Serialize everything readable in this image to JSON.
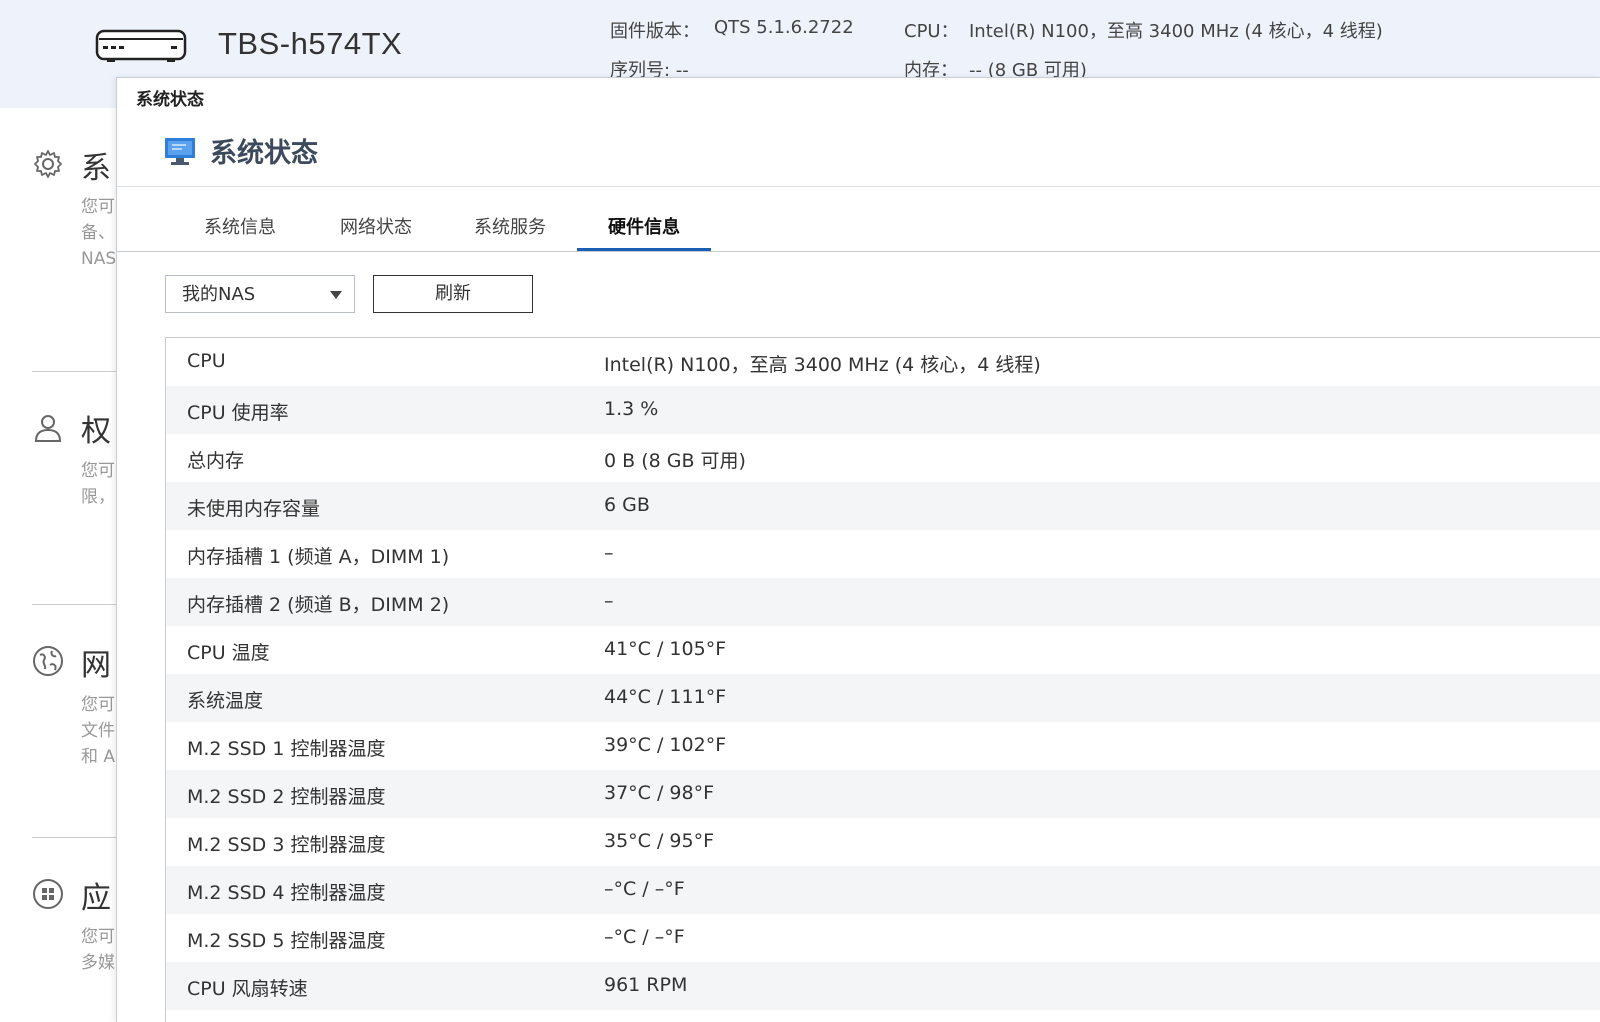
{
  "header": {
    "device_name": "TBS-h574TX",
    "firmware_label": "固件版本：",
    "firmware_value": "QTS 5.1.6.2722",
    "serial_label": "序列号: --",
    "cpu_label": "CPU：",
    "cpu_value": "Intel(R) N100，至高 3400 MHz (4 核心，4 线程)",
    "memory_label": "内存：",
    "memory_value": "-- (8 GB 可用)"
  },
  "background_sections": [
    {
      "title": "系",
      "desc": [
        "您可",
        "备、",
        "NAS"
      ],
      "icon": "gear-icon"
    },
    {
      "title": "权",
      "desc": [
        "您可",
        "限，"
      ],
      "icon": "user-icon"
    },
    {
      "title": "网",
      "desc": [
        "您可",
        "文件",
        "和 A"
      ],
      "icon": "globe-icon"
    },
    {
      "title": "应",
      "desc": [
        "您可",
        "多媒"
      ],
      "icon": "apps-icon"
    }
  ],
  "window": {
    "title": "系统状态",
    "app_title": "系统状态",
    "tabs": [
      {
        "label": "系统信息",
        "active": false
      },
      {
        "label": "网络状态",
        "active": false
      },
      {
        "label": "系统服务",
        "active": false
      },
      {
        "label": "硬件信息",
        "active": true
      }
    ],
    "device_select": "我的NAS",
    "refresh_label": "刷新"
  },
  "hardware_rows": [
    {
      "label": "CPU",
      "value": "Intel(R) N100，至高 3400 MHz (4 核心，4 线程)"
    },
    {
      "label": "CPU 使用率",
      "value": "1.3 %"
    },
    {
      "label": "总内存",
      "value": "0 B (8 GB 可用)"
    },
    {
      "label": "未使用内存容量",
      "value": "6 GB"
    },
    {
      "label": "内存插槽 1 (频道 A，DIMM 1)",
      "value": "–"
    },
    {
      "label": "内存插槽 2 (频道 B，DIMM 2)",
      "value": "–"
    },
    {
      "label": "CPU 温度",
      "value": "41°C / 105°F"
    },
    {
      "label": "系统温度",
      "value": "44°C / 111°F"
    },
    {
      "label": "M.2 SSD 1 控制器温度",
      "value": "39°C / 102°F"
    },
    {
      "label": "M.2 SSD 2 控制器温度",
      "value": "37°C / 98°F"
    },
    {
      "label": "M.2 SSD 3 控制器温度",
      "value": "35°C / 95°F"
    },
    {
      "label": "M.2 SSD 4 控制器温度",
      "value": "–°C / –°F"
    },
    {
      "label": "M.2 SSD 5 控制器温度",
      "value": "–°C / –°F"
    },
    {
      "label": "CPU 风扇转速",
      "value": "961 RPM"
    }
  ],
  "colors": {
    "header_bg": "#eef3fb",
    "tab_active_underline": "#1a5fb4",
    "row_alt": "#f4f5f7"
  }
}
